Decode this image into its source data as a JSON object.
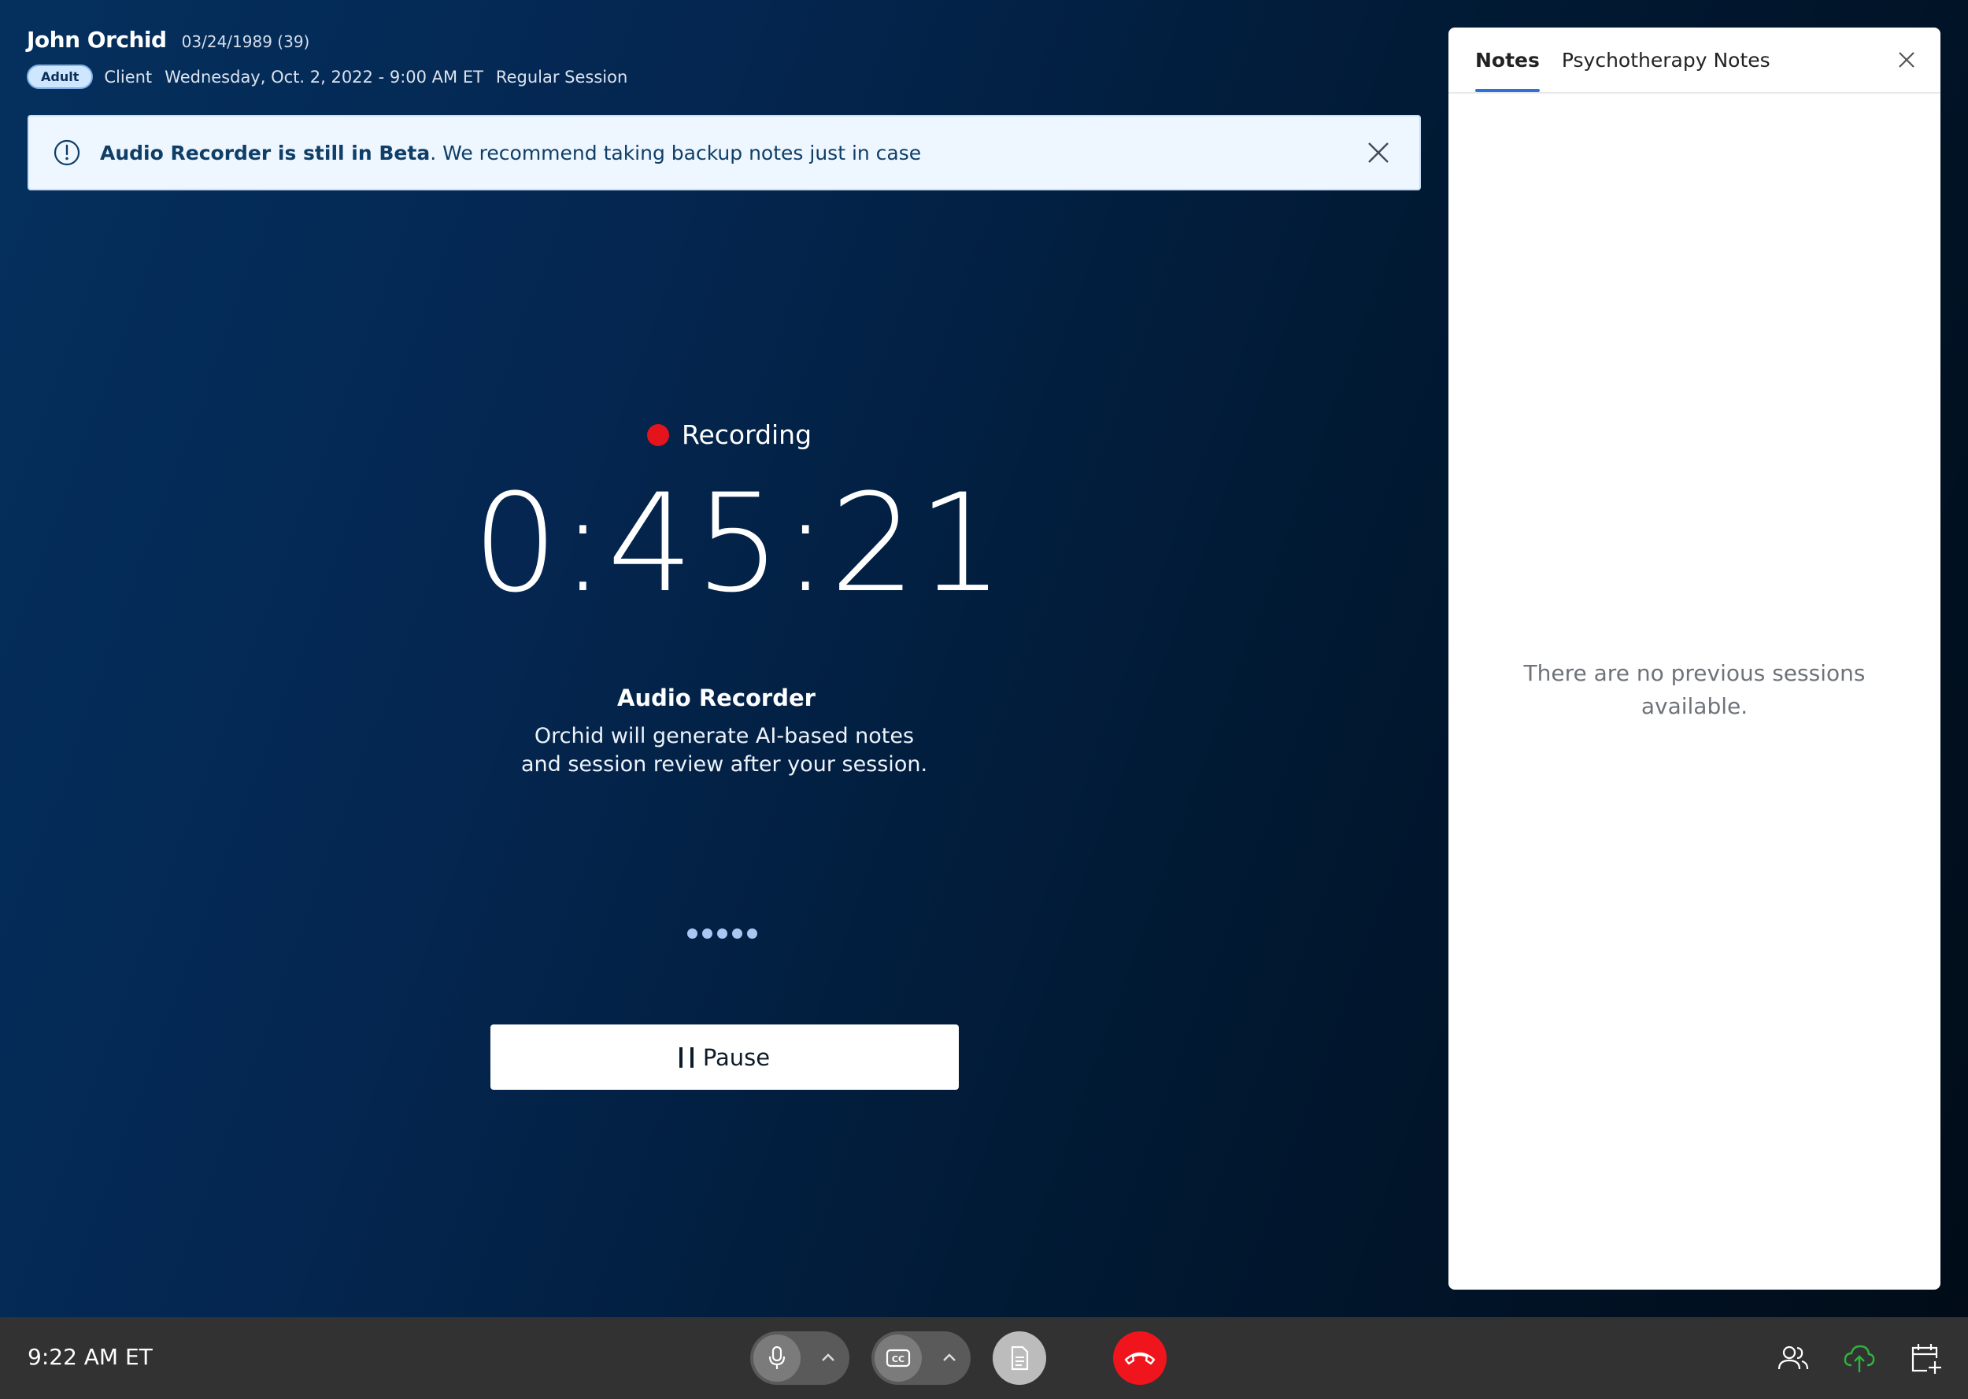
{
  "header": {
    "client_name": "John Orchid",
    "dob_age": "03/24/1989 (39)",
    "badge": "Adult",
    "role": "Client",
    "session_datetime": "Wednesday, Oct. 2, 2022 - 9:00 AM ET",
    "session_type": "Regular Session"
  },
  "banner": {
    "bold_text": "Audio Recorder is still in Beta",
    "rest_text": ". We recommend taking backup notes just in case",
    "icon": "info-circle-icon"
  },
  "recorder": {
    "status": "Recording",
    "timer": "0:45:21",
    "title": "Audio Recorder",
    "description_line1": "Orchid will generate AI-based notes",
    "description_line2": "and session review after your session.",
    "pause_label": "Pause"
  },
  "panel": {
    "tabs": [
      {
        "label": "Notes",
        "active": true
      },
      {
        "label": "Psychotherapy Notes",
        "active": false
      }
    ],
    "empty_message_line1": "There are no previous sessions",
    "empty_message_line2": "available."
  },
  "bottom_bar": {
    "clock": "9:22 AM ET",
    "icons": [
      "microphone-icon",
      "closed-captions-icon",
      "document-icon",
      "end-call-icon",
      "participants-icon",
      "cloud-upload-icon",
      "calendar-add-icon"
    ]
  },
  "colors": {
    "recording_dot": "#e4131c",
    "end_call": "#f0151d",
    "tab_accent": "#2d73d6",
    "upload_icon": "#2fb43d"
  }
}
